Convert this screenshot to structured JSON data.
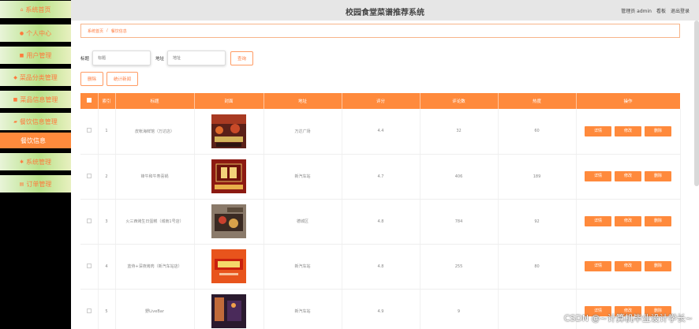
{
  "app": {
    "title": "校园食堂菜谱推荐系统"
  },
  "header": {
    "user": "管理员 admin",
    "view_label": "看板",
    "logout_label": "退出登录"
  },
  "sidebar": {
    "items": [
      {
        "label": "系统首页",
        "icon": "home-icon"
      },
      {
        "label": "个人中心",
        "icon": "user-icon"
      },
      {
        "label": "用户管理",
        "icon": "users-icon"
      },
      {
        "label": "菜品分类管理",
        "icon": "tag-icon"
      },
      {
        "label": "菜品信息管理",
        "icon": "list-icon"
      },
      {
        "label": "餐饮信息管理",
        "icon": "folder-icon"
      },
      {
        "label": "系统管理",
        "icon": "gear-icon"
      },
      {
        "label": "订单管理",
        "icon": "order-icon"
      }
    ],
    "active_sub": "餐饮信息"
  },
  "breadcrumb": {
    "home": "系统首页",
    "separator": "/",
    "current": "餐饮信息"
  },
  "search": {
    "title_label": "标题",
    "title_placeholder": "标题",
    "address_label": "地址",
    "address_placeholder": "地址",
    "query_button": "查询"
  },
  "actions": {
    "delete_button": "删除",
    "stats_button": "统计新闻"
  },
  "table": {
    "headers": [
      "索引",
      "标题",
      "封面",
      "地址",
      "评分",
      "评论数",
      "热度",
      "操作"
    ],
    "rows": [
      {
        "index": "1",
        "title": "皮帐海鲜馆（万达店）",
        "address": "万达广场",
        "rating": "4.4",
        "comments": "32",
        "heat": "60"
      },
      {
        "index": "2",
        "title": "锋牛和牛寿喜锅",
        "address": "新汽车站",
        "rating": "4.7",
        "comments": "406",
        "heat": "189"
      },
      {
        "index": "3",
        "title": "火三西烤生日蛋糕（城南1号店）",
        "address": "德城区",
        "rating": "4.8",
        "comments": "784",
        "heat": "92"
      },
      {
        "index": "4",
        "title": "蓝侍+深夜烤肉（新汽车站店）",
        "address": "新汽车站",
        "rating": "4.8",
        "comments": "255",
        "heat": "80"
      },
      {
        "index": "5",
        "title": "野LiveBar",
        "address": "新汽车站",
        "rating": "4.9",
        "comments": "9",
        "heat": ""
      }
    ],
    "row_buttons": {
      "detail": "详情",
      "edit": "修改",
      "delete": "删除"
    }
  },
  "watermark": "CSDN @~计算机毕业设计学长~",
  "colors": {
    "accent": "#ff8a3c",
    "sidebar_bg": "#000000",
    "header_bg": "#e6e6e6"
  }
}
